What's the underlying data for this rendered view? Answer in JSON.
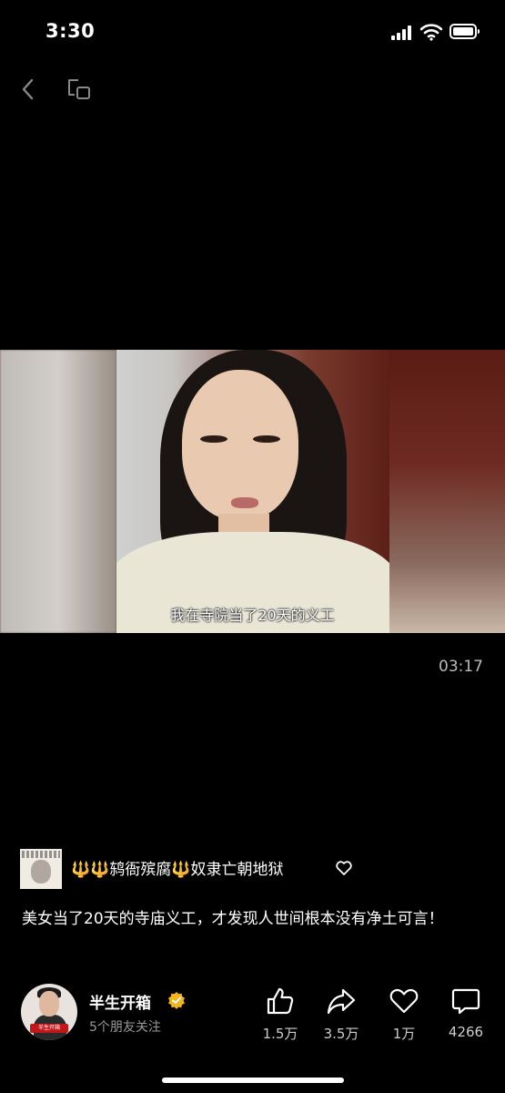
{
  "status_bar": {
    "time": "3:30"
  },
  "video": {
    "subtitle": "我在寺院当了20天的义工",
    "duration": "03:17"
  },
  "source": {
    "title": "🔱🔱鸫衙殡腐🔱奴隶亡朝地狱"
  },
  "caption": "美女当了20天的寺庙义工，才发现人世间根本没有净土可言！",
  "author": {
    "name": "半生开箱",
    "followers": "5个朋友关注",
    "avatar_text": "半生开箱"
  },
  "actions": [
    {
      "icon": "thumbs-up-icon",
      "count": "1.5万"
    },
    {
      "icon": "share-icon",
      "count": "3.5万"
    },
    {
      "icon": "heart-icon",
      "count": "1万"
    },
    {
      "icon": "comment-icon",
      "count": "4266"
    }
  ]
}
